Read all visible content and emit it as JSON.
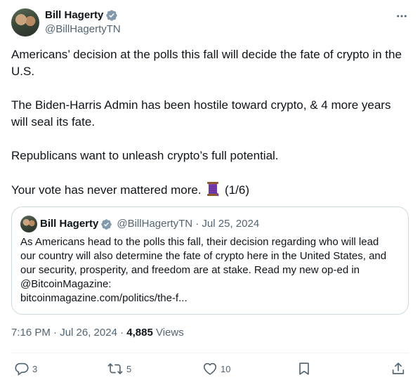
{
  "author": {
    "name": "Bill Hagerty",
    "handle": "@BillHagertyTN",
    "verified_icon": "verified-badge-icon",
    "more_icon": "more-options-icon"
  },
  "tweet": {
    "paragraphs": [
      "Americans’ decision at the polls this fall will decide the fate of crypto in the U.S.",
      "The Biden-Harris Admin has been hostile toward crypto, & 4 more years will seal its fate.",
      "Republicans want to unleash crypto’s full potential."
    ],
    "last_line_before_emoji": "Your vote has never mattered more.",
    "emoji": "thread-spool-icon",
    "last_line_after_emoji": "(1/6)"
  },
  "quote": {
    "name": "Bill Hagerty",
    "meta": "@BillHagertyTN · Jul 25, 2024",
    "text_lines": [
      "As Americans head to the polls this fall, their decision regarding who will lead",
      "our country will also determine the fate of crypto here in the United States, and",
      "our security, prosperity, and freedom are at stake. Read my new op-ed in",
      "@BitcoinMagazine:",
      "bitcoinmagazine.com/politics/the-f..."
    ]
  },
  "timestamp": {
    "time_date": "7:16 PM · Jul 26, 2024 ·",
    "views_count": "4,885",
    "views_label": "Views"
  },
  "actions": {
    "reply_count": "3",
    "repost_count": "5",
    "like_count": "10"
  },
  "colors": {
    "text": "#0f1419",
    "secondary": "#536471",
    "verified": "#829aab",
    "border": "#cfd9de"
  }
}
